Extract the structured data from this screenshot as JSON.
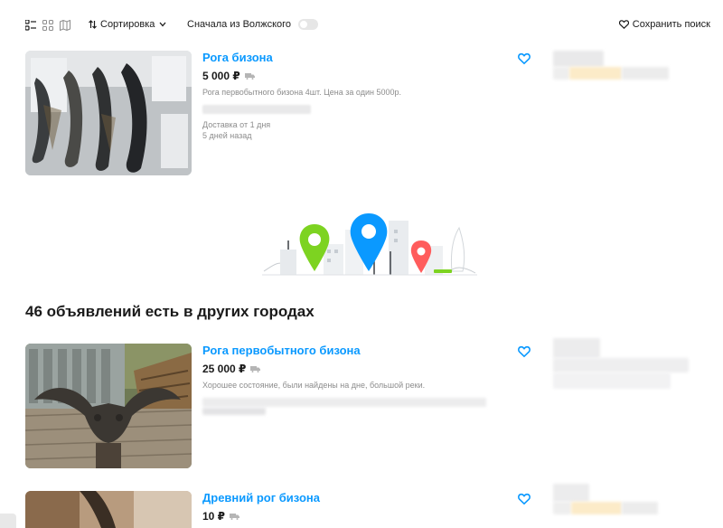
{
  "toolbar": {
    "sort_label": "Сортировка",
    "local_first_label": "Сначала из Волжского",
    "local_first_on": false,
    "save_search_label": "Сохранить поиск"
  },
  "listings": [
    {
      "title": "Рога бизона",
      "price": "5 000 ₽",
      "description": "Рога первобытного бизона 4шт. Цена за один 5000р.",
      "delivery": "Доставка от 1 дня",
      "posted": "5 дней назад",
      "favorite": false
    },
    {
      "title": "Рога первобытного бизона",
      "price": "25 000 ₽",
      "description": "Хорошее состояние, были найдены на дне, большой реки.",
      "favorite": false
    },
    {
      "title": "Древний рог бизона",
      "price": "10 ₽",
      "favorite": false
    }
  ],
  "other_cities": {
    "heading": "46 объявлений есть в других городах"
  },
  "colors": {
    "accent": "#0a99ff",
    "pin_green": "#7dd321",
    "pin_blue": "#0a99ff",
    "pin_red": "#ff5c5c"
  },
  "icons": {
    "view_list": "list-view-icon",
    "view_grid": "grid-view-icon",
    "view_map": "map-view-icon",
    "sort": "sort-arrows-icon",
    "favorite": "heart-icon",
    "delivery": "truck-icon"
  }
}
